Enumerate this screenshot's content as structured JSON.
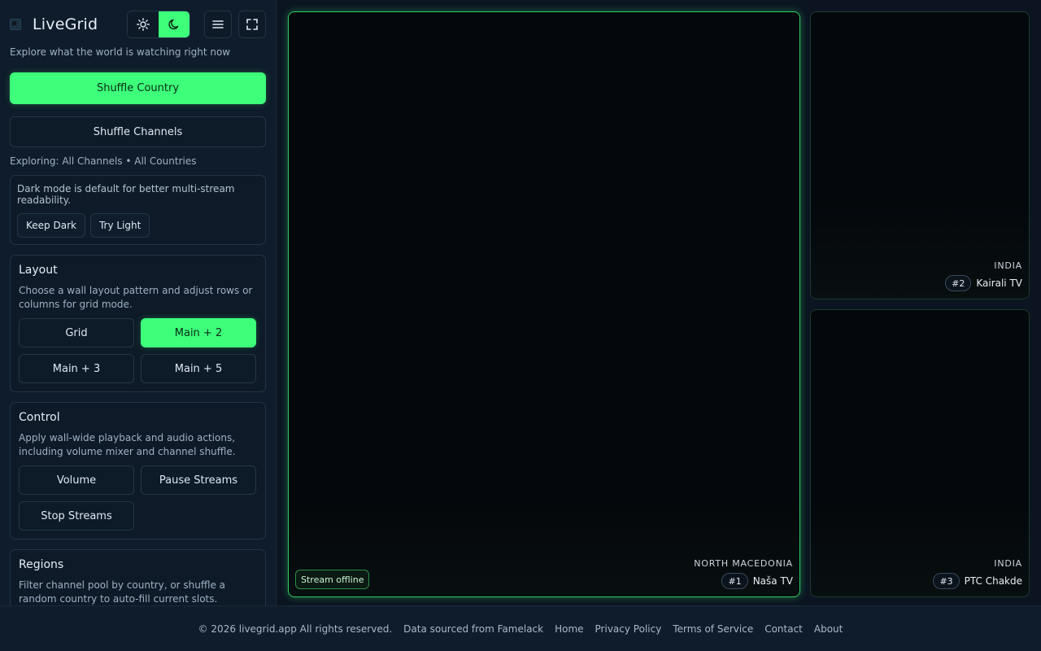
{
  "app": {
    "title": "LiveGrid",
    "tagline": "Explore what the world is watching right now"
  },
  "toolbar": {
    "theme_light_icon": "sun-icon",
    "theme_dark_icon": "moon-icon",
    "menu_icon": "menu-icon",
    "fullscreen_icon": "fullscreen-icon",
    "active_theme": "dark"
  },
  "sidebar": {
    "shuffle_country": "Shuffle Country",
    "shuffle_channels": "Shuffle Channels",
    "exploring": "Exploring: All Channels • All Countries",
    "notice": {
      "text": "Dark mode is default for better multi-stream readability.",
      "keep_dark": "Keep Dark",
      "try_light": "Try Light"
    },
    "layout": {
      "title": "Layout",
      "description": "Choose a wall layout pattern and adjust rows or columns for grid mode.",
      "options": [
        "Grid",
        "Main + 2",
        "Main + 3",
        "Main + 5"
      ],
      "selected": "Main + 2"
    },
    "control": {
      "title": "Control",
      "description": "Apply wall-wide playback and audio actions, including volume mixer and channel shuffle.",
      "volume": "Volume",
      "pause": "Pause Streams",
      "stop": "Stop Streams"
    },
    "regions": {
      "title": "Regions",
      "description": "Filter channel pool by country, or shuffle a random country to auto-fill current slots."
    }
  },
  "tiles": [
    {
      "country": "North Macedonia",
      "number": "#1",
      "name": "Naša TV",
      "status": "Stream offline"
    },
    {
      "country": "India",
      "number": "#2",
      "name": "Kairali TV"
    },
    {
      "country": "India",
      "number": "#3",
      "name": "PTC Chakde"
    }
  ],
  "footer": {
    "copyright": "© 2026 livegrid.app All rights reserved.",
    "source": "Data sourced from Famelack",
    "links": [
      "Home",
      "Privacy Policy",
      "Terms of Service",
      "Contact",
      "About"
    ]
  },
  "colors": {
    "accent": "#3dff7a",
    "background": "#0b1420",
    "panel": "#0f1c2b"
  }
}
